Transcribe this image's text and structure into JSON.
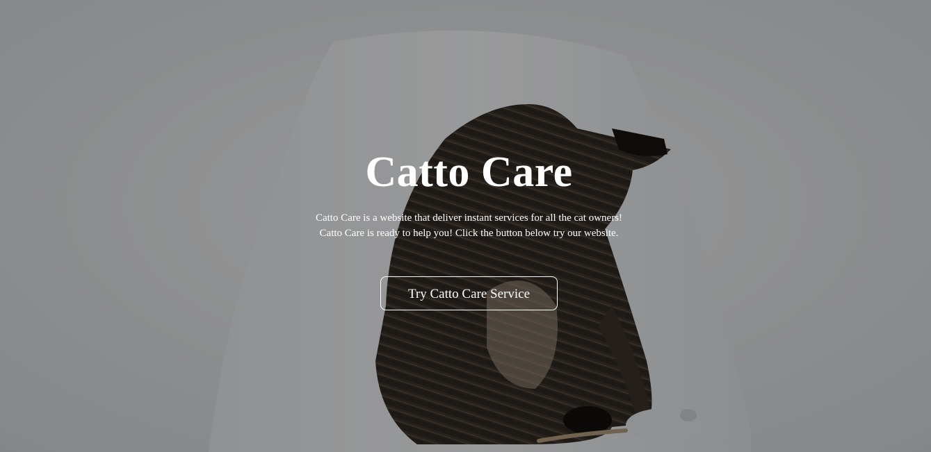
{
  "hero": {
    "title": "Catto Care",
    "description_line1": "Catto Care is a website that deliver instant services for all the cat owners!",
    "description_line2": "Catto Care is ready to help you! Click the button below try our website.",
    "cta_label": "Try Catto Care Service",
    "overlay_color": "#000000",
    "text_color": "#ffffff",
    "background_image": "tabby-cat-playing-with-toy-mouse-on-white-chair"
  }
}
